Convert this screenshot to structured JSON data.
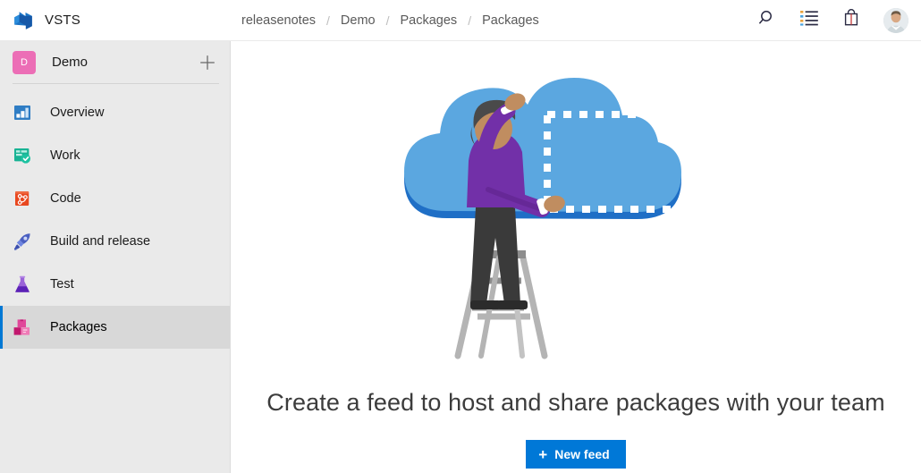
{
  "header": {
    "brand_name": "VSTS",
    "brand_logo_icon": "vsts-logo-icon",
    "breadcrumb": [
      "releasenotes",
      "Demo",
      "Packages",
      "Packages"
    ],
    "breadcrumb_separator": "/",
    "actions": [
      {
        "name": "search-icon",
        "label": "Search"
      },
      {
        "name": "work-items-list-icon",
        "label": "Work items"
      },
      {
        "name": "marketplace-bag-icon",
        "label": "Marketplace"
      },
      {
        "name": "user-avatar",
        "label": "Account"
      }
    ]
  },
  "sidebar": {
    "project": {
      "initial": "D",
      "name": "Demo",
      "avatar_color": "#ec6eb6",
      "add_label": "+"
    },
    "items": [
      {
        "label": "Overview",
        "icon": "overview-icon",
        "selected": false
      },
      {
        "label": "Work",
        "icon": "work-icon",
        "selected": false
      },
      {
        "label": "Code",
        "icon": "code-icon",
        "selected": false
      },
      {
        "label": "Build and release",
        "icon": "build-and-release-icon",
        "selected": false
      },
      {
        "label": "Test",
        "icon": "test-icon",
        "selected": false
      },
      {
        "label": "Packages",
        "icon": "packages-icon",
        "selected": true
      }
    ],
    "background_color": "#eaeaea",
    "selected_background_color": "#d8d8d8",
    "selected_accent_color": "#0078d4"
  },
  "main": {
    "illustration": "person-on-ladder-placing-feed-on-cloud",
    "headline": "Create a feed to host and share packages with your team",
    "new_feed_button": {
      "label": "New feed",
      "plus": "+",
      "color": "#0078d7"
    }
  }
}
